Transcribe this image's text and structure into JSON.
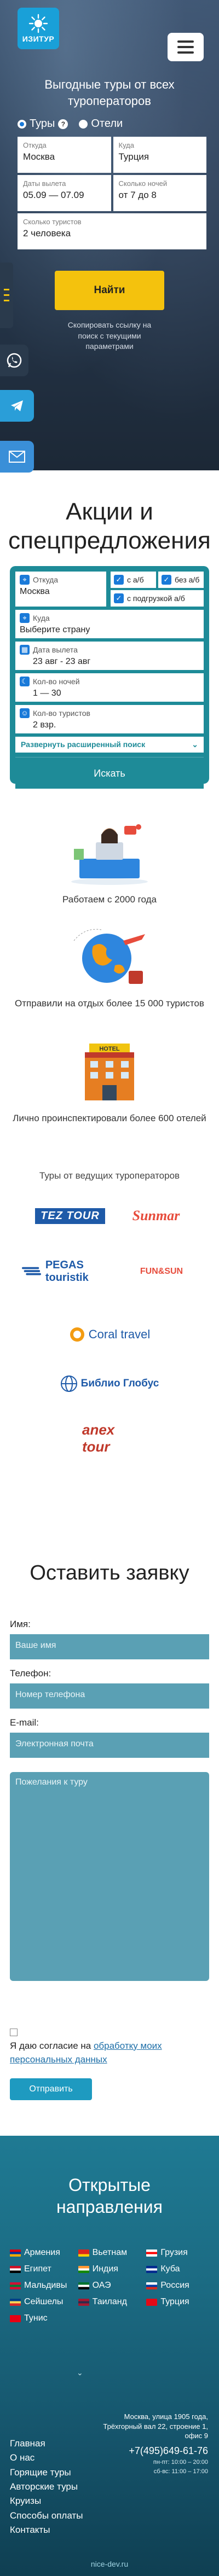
{
  "header": {
    "brand": "ИЗИТУР",
    "hero_title": "Выгодные туры от всех туроператоров"
  },
  "search": {
    "mode_tours": "Туры",
    "mode_hotels": "Отели",
    "help_mark": "?",
    "from_label": "Откуда",
    "from_value": "Москва",
    "to_label": "Куда",
    "to_value": "Турция",
    "dates_label": "Даты вылета",
    "dates_value": "05.09 — 07.09",
    "nights_label": "Сколько ночей",
    "nights_value": "от 7 до 8",
    "tourists_label": "Сколько туристов",
    "tourists_value": "2 человека",
    "find_button": "Найти",
    "copy_link": "Скопировать ссылку на поиск с текущими параметрами"
  },
  "promo": {
    "title": "Акции и спецпредложения",
    "from_label": "Откуда",
    "from_value": "Москва",
    "with_flight": "с а/б",
    "without_flight": "без а/б",
    "with_transfer": "с подгрузкой а/б",
    "to_label": "Куда",
    "to_value": "Выберите страну",
    "dates_label": "Дата вылета",
    "dates_value": "23 авг - 23 авг",
    "nights_label": "Кол-во ночей",
    "nights_value": "1 — 30",
    "tourists_label": "Кол-во туристов",
    "tourists_value": "2 взр.",
    "expand": "Развернуть расширенный поиск",
    "search_button": "Искать"
  },
  "features": [
    {
      "caption": "Работаем с 2000 года"
    },
    {
      "caption": "Отправили на отдых более 15 000 туристов"
    },
    {
      "caption": "Лично проинспектировали более 600 отелей",
      "hotel_sign": "HOTEL"
    }
  ],
  "partners": {
    "title": "Туры от ведущих туроператоров",
    "items": [
      "TEZ TOUR",
      "Sunmar",
      "PEGAS touristik",
      "FUN&SUN",
      "Coral travel",
      "Библио Глобус",
      "anex tour"
    ]
  },
  "form": {
    "title": "Оставить заявку",
    "name_label": "Имя:",
    "name_placeholder": "Ваше имя",
    "phone_label": "Телефон:",
    "phone_placeholder": "Номер телефона",
    "email_label": "E-mail:",
    "email_placeholder": "Электронная почта",
    "wishes_placeholder": "Пожелания к туру",
    "consent_text": "Я даю согласие на",
    "consent_link": "обработку моих персональных данных",
    "submit": "Отправить"
  },
  "destinations": {
    "title": "Открытые направления",
    "countries": [
      {
        "name": "Армения",
        "flag": [
          "#d90012",
          "#0033a0",
          "#f2a800"
        ]
      },
      {
        "name": "Вьетнам",
        "flag": [
          "#da251d",
          "#da251d",
          "#ffcd00"
        ]
      },
      {
        "name": "Грузия",
        "flag": [
          "#ffffff",
          "#ff0000",
          "#ffffff"
        ]
      },
      {
        "name": "Египет",
        "flag": [
          "#ce1126",
          "#ffffff",
          "#000000"
        ]
      },
      {
        "name": "Индия",
        "flag": [
          "#ff9933",
          "#ffffff",
          "#138808"
        ]
      },
      {
        "name": "Куба",
        "flag": [
          "#002a8f",
          "#ffffff",
          "#002a8f"
        ]
      },
      {
        "name": "Мальдивы",
        "flag": [
          "#d21034",
          "#007e3a",
          "#d21034"
        ]
      },
      {
        "name": "ОАЭ",
        "flag": [
          "#00732f",
          "#ffffff",
          "#000000"
        ]
      },
      {
        "name": "Россия",
        "flag": [
          "#ffffff",
          "#0039a6",
          "#d52b1e"
        ]
      },
      {
        "name": "Сейшелы",
        "flag": [
          "#003f87",
          "#fcd856",
          "#d62828"
        ]
      },
      {
        "name": "Таиланд",
        "flag": [
          "#a51931",
          "#2d2a4a",
          "#a51931"
        ]
      },
      {
        "name": "Турция",
        "flag": [
          "#e30a17",
          "#e30a17",
          "#e30a17"
        ]
      },
      {
        "name": "Тунис",
        "flag": [
          "#e70013",
          "#e70013",
          "#e70013"
        ]
      }
    ],
    "more": "⌄"
  },
  "footer": {
    "nav": [
      "Главная",
      "О нас",
      "Горящие туры",
      "Авторские туры",
      "Круизы",
      "Способы оплаты",
      "Контакты"
    ],
    "address": "Москва, улица 1905 года, Трёхгорный вал 22, строение 1, офис 9",
    "phone": "+7(495)649-61-76",
    "hours_weekdays": "пн-пт: 10:00 – 20:00",
    "hours_weekend": "сб-вс: 11:00 – 17:00",
    "developer": "nice-dev.ru"
  },
  "colors": {
    "accent": "#1e8b98",
    "button_yellow": "#f4c20d",
    "form_field": "#5aa0b4"
  }
}
